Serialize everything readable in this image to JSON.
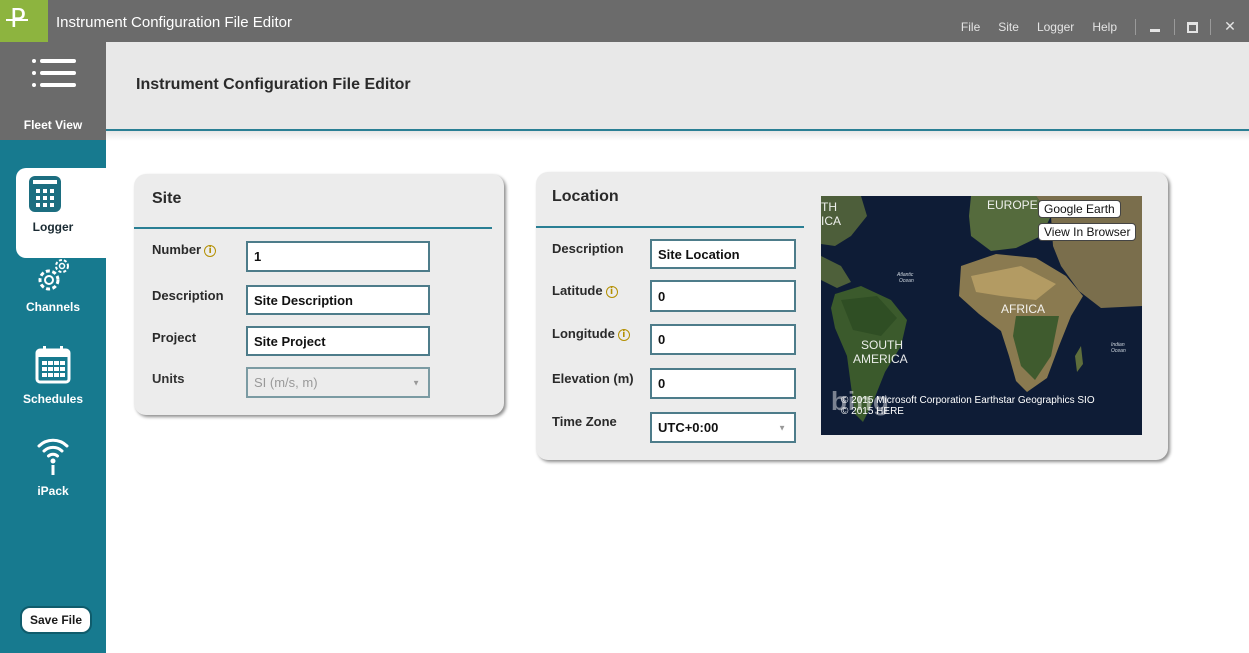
{
  "app": {
    "logo_letter": "P",
    "title": "Instrument Configuration File Editor"
  },
  "menu": {
    "items": [
      "File",
      "Site",
      "Logger",
      "Help"
    ],
    "window_close": "✕"
  },
  "nav": {
    "fleet_view": "Fleet View",
    "items": [
      {
        "label": "Logger",
        "icon": "logger-icon",
        "active": true
      },
      {
        "label": "Channels",
        "icon": "gears-icon",
        "active": false
      },
      {
        "label": "Schedules",
        "icon": "calendar-icon",
        "active": false
      },
      {
        "label": "iPack",
        "icon": "wifi-icon",
        "active": false
      }
    ],
    "save_file": "Save File"
  },
  "header": {
    "title": "Instrument Configuration File Editor"
  },
  "site": {
    "title": "Site",
    "number_label": "Number",
    "number_value": "1",
    "description_label": "Description",
    "description_value": "Site Description",
    "project_label": "Project",
    "project_value": "Site Project",
    "units_label": "Units",
    "units_value": "SI (m/s, m)"
  },
  "location": {
    "title": "Location",
    "description_label": "Description",
    "description_value": "Site Location",
    "latitude_label": "Latitude",
    "latitude_value": "0",
    "longitude_label": "Longitude",
    "longitude_value": "0",
    "elevation_label": "Elevation (m)",
    "elevation_value": "0",
    "timezone_label": "Time Zone",
    "timezone_value": "UTC+0:00"
  },
  "map": {
    "google_earth": "Google Earth",
    "view_in_browser": "View In Browser",
    "labels": {
      "europe": "EUROPE",
      "africa": "AFRICA",
      "south_america_1": "SOUTH",
      "south_america_2": "AMERICA",
      "north_america_1": "TH",
      "north_america_2": "ICA",
      "atlantic_1": "Atlantic",
      "atlantic_2": "Ocean",
      "indian_1": "Indian",
      "indian_2": "Ocean"
    },
    "credit_1": "© 2015 Microsoft Corporation   Earthstar Geographics  SIO",
    "credit_2": "© 2015 HERE",
    "bing": "bing"
  },
  "colors": {
    "accent": "#177a8f",
    "titlebar": "#6b6b6b",
    "logo": "#8db43f"
  }
}
